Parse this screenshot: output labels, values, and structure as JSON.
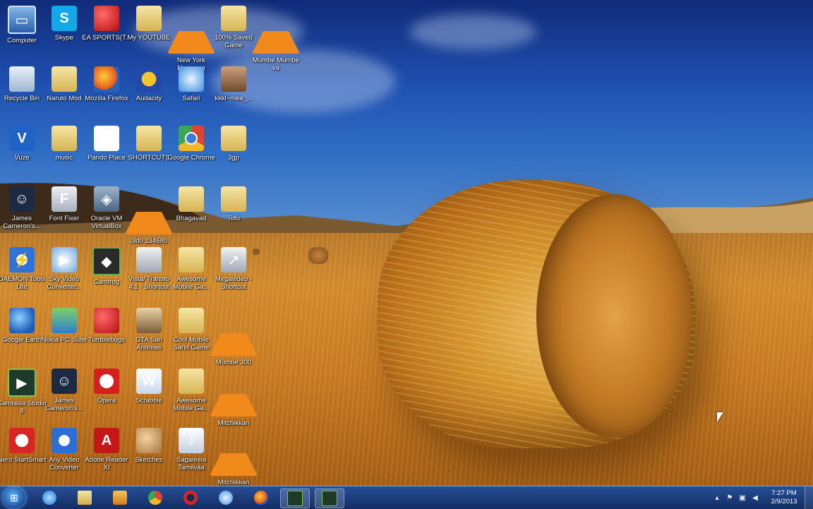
{
  "desktop": {
    "icons": [
      {
        "label": "Computer",
        "icon": "computer-icon"
      },
      {
        "label": "Skype",
        "icon": "skype-icon"
      },
      {
        "label": "EA SPORTS(T...",
        "icon": "cricket-ball-icon"
      },
      {
        "label": "My YOUTUBE",
        "icon": "folder-icon"
      },
      {
        "label": "New York Nagaram",
        "icon": "vlc-icon"
      },
      {
        "label": "100% Saved Game",
        "icon": "folder-icon"
      },
      {
        "label": "Mumbe Mumbe va",
        "icon": "vlc-icon"
      },
      {
        "label": "Recycle Bin",
        "icon": "recycle-bin-icon"
      },
      {
        "label": "Naruto Mod",
        "icon": "folder-icon"
      },
      {
        "label": "Mozilla Firefox",
        "icon": "firefox-icon"
      },
      {
        "label": "Audacity",
        "icon": "audacity-icon"
      },
      {
        "label": "Safari",
        "icon": "safari-icon"
      },
      {
        "label": "kkkl~mea_...",
        "icon": "photo-icon"
      },
      {
        "label": "Vuze",
        "icon": "vuze-icon"
      },
      {
        "label": "music",
        "icon": "folder-icon"
      },
      {
        "label": "Pando Place",
        "icon": "links-icon"
      },
      {
        "label": "SHORTCUTS",
        "icon": "folder-icon"
      },
      {
        "label": "Google Chrome",
        "icon": "chrome-icon"
      },
      {
        "label": "3gp",
        "icon": "folder-icon"
      },
      {
        "label": "James Cameron's...",
        "icon": "avatar-game-icon"
      },
      {
        "label": "Font Fixer",
        "icon": "font-icon"
      },
      {
        "label": "Oracle VM VirtualBox",
        "icon": "virtualbox-icon"
      },
      {
        "label": "0ld0 134680",
        "icon": "vlc-icon"
      },
      {
        "label": "Bhagavad",
        "icon": "folder-icon"
      },
      {
        "label": "Tofu",
        "icon": "folder-icon"
      },
      {
        "label": "DAEMON Tools Lite",
        "icon": "daemon-icon"
      },
      {
        "label": "Sky Video Converter...",
        "icon": "sky-video-icon"
      },
      {
        "label": "Camfrog",
        "icon": "camfrog-icon"
      },
      {
        "label": "Vista/ Transfo 4.1 - Shortcut",
        "icon": "tweaks-icon"
      },
      {
        "label": "Awesome Mobile Ga...",
        "icon": "folder-icon"
      },
      {
        "label": "Megavideo - Shortcut",
        "icon": "shortcut-icon"
      },
      {
        "label": "Google Earth",
        "icon": "google-earth-icon"
      },
      {
        "label": "Nokia PC Suite",
        "icon": "nokia-icon"
      },
      {
        "label": "Tumblebugs",
        "icon": "ladybug-icon"
      },
      {
        "label": "GTA San Andreas",
        "icon": "gta-icon"
      },
      {
        "label": "Cool Mobile Sand Game",
        "icon": "folder-icon"
      },
      {
        "label": "Mumbe 300",
        "icon": "vlc-icon"
      },
      {
        "label": "Camtasia Studio 8",
        "icon": "camtasia-icon"
      },
      {
        "label": "James Cameron's...",
        "icon": "avatar-game-icon"
      },
      {
        "label": "Opera",
        "icon": "opera-icon"
      },
      {
        "label": "Scrabble",
        "icon": "word-doc-icon"
      },
      {
        "label": "Awesome Mobile Ga...",
        "icon": "folder-icon"
      },
      {
        "label": "Mitchikkan",
        "icon": "vlc-icon"
      },
      {
        "label": "Nero StartSmart",
        "icon": "nero-icon"
      },
      {
        "label": "Any Video Converter",
        "icon": "any-video-icon"
      },
      {
        "label": "Adobe Reader XI",
        "icon": "pdf-icon"
      },
      {
        "label": "Sketches",
        "icon": "palette-icon"
      },
      {
        "label": "Sagaleela Tamilvaa",
        "icon": "music-file-icon"
      },
      {
        "label": "Mitchikkan",
        "icon": "vlc-icon"
      }
    ]
  },
  "taskbar": {
    "start_label": "Start",
    "pinned": [
      {
        "name": "Internet Explorer",
        "icon": "ie-icon"
      },
      {
        "name": "Windows Explorer",
        "icon": "folder-icon"
      },
      {
        "name": "Windows Media Player",
        "icon": "media-player-icon"
      },
      {
        "name": "Google Chrome",
        "icon": "chrome-icon"
      },
      {
        "name": "Opera",
        "icon": "opera-icon"
      },
      {
        "name": "Safari",
        "icon": "safari-icon"
      },
      {
        "name": "Mozilla Firefox",
        "icon": "firefox-icon"
      },
      {
        "name": "Camtasia Studio",
        "icon": "camtasia-icon"
      },
      {
        "name": "Camtasia Recorder",
        "icon": "camtasia-icon"
      }
    ],
    "time": "7:27 PM",
    "date": "2/9/2013"
  }
}
